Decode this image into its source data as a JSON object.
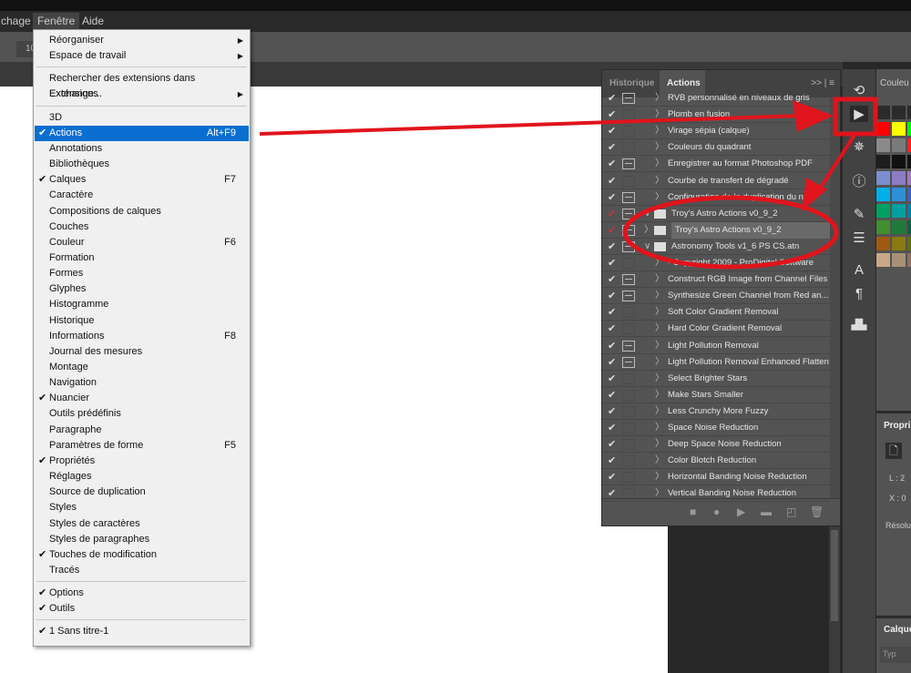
{
  "menubar": [
    "chage",
    "Fenêtre",
    "Aide"
  ],
  "optbar_value": "10",
  "menu": [
    {
      "label": "Réorganiser",
      "sub": true
    },
    {
      "label": "Espace de travail",
      "sub": true
    },
    {
      "sep": true
    },
    {
      "label": "Rechercher des extensions dans Exchange..."
    },
    {
      "label": "Extensions",
      "sub": true
    },
    {
      "sep": true
    },
    {
      "label": "3D"
    },
    {
      "label": "Actions",
      "check": true,
      "shortcut": "Alt+F9",
      "selected": true
    },
    {
      "label": "Annotations"
    },
    {
      "label": "Bibliothèques"
    },
    {
      "label": "Calques",
      "check": true,
      "shortcut": "F7"
    },
    {
      "label": "Caractère"
    },
    {
      "label": "Compositions de calques"
    },
    {
      "label": "Couches"
    },
    {
      "label": "Couleur",
      "shortcut": "F6"
    },
    {
      "label": "Formation"
    },
    {
      "label": "Formes"
    },
    {
      "label": "Glyphes"
    },
    {
      "label": "Histogramme"
    },
    {
      "label": "Historique"
    },
    {
      "label": "Informations",
      "shortcut": "F8"
    },
    {
      "label": "Journal des mesures"
    },
    {
      "label": "Montage"
    },
    {
      "label": "Navigation"
    },
    {
      "label": "Nuancier",
      "check": true
    },
    {
      "label": "Outils prédéfinis"
    },
    {
      "label": "Paragraphe"
    },
    {
      "label": "Paramètres de forme",
      "shortcut": "F5"
    },
    {
      "label": "Propriétés",
      "check": true
    },
    {
      "label": "Réglages"
    },
    {
      "label": "Source de duplication"
    },
    {
      "label": "Styles"
    },
    {
      "label": "Styles de caractères"
    },
    {
      "label": "Styles de paragraphes"
    },
    {
      "label": "Touches de modification",
      "check": true
    },
    {
      "label": "Tracés"
    },
    {
      "sep": true
    },
    {
      "label": "Options",
      "check": true
    },
    {
      "label": "Outils",
      "check": true
    },
    {
      "sep": true
    },
    {
      "label": "1 Sans titre-1",
      "check": true
    }
  ],
  "panel": {
    "tabs": [
      "Historique",
      "Actions"
    ],
    "menu_glyphs": ">>  |  ≡",
    "rows": [
      {
        "label": "RVB personnalisé en niveaux de gris",
        "dlg": true
      },
      {
        "label": "Plomb en fusion"
      },
      {
        "label": "Virage sépia (calque)"
      },
      {
        "label": "Couleurs du quadrant"
      },
      {
        "label": "Enregistrer au format Photoshop PDF",
        "dlg": true
      },
      {
        "label": "Courbe de transfert de dégradé"
      },
      {
        "label": "Configuration de la duplication du ni...",
        "dlg": true
      },
      {
        "label": "Troy's Astro Actions v0_9_2",
        "dlg": true,
        "red": true,
        "folder": true,
        "tw": "∨"
      },
      {
        "label": "Troy's Astro Actions v0_9_2",
        "dlg": true,
        "red": true,
        "folder": true,
        "hl": true
      },
      {
        "label": "Astronomy Tools v1_6 PS CS.atn",
        "dlg": true,
        "folder": true,
        "tw": "∨"
      },
      {
        "label": "- Copyright 2009 - ProDigital Software"
      },
      {
        "label": "Construct RGB Image from Channel Files",
        "dlg": true
      },
      {
        "label": "Synthesize Green Channel from Red an...",
        "dlg": true
      },
      {
        "label": "Soft Color Gradient Removal"
      },
      {
        "label": "Hard Color Gradient Removal"
      },
      {
        "label": "Light Pollution Removal",
        "dlg": true
      },
      {
        "label": "Light Pollution Removal Enhanced Flatten",
        "dlg": true
      },
      {
        "label": "Select Brighter Stars"
      },
      {
        "label": "Make Stars Smaller"
      },
      {
        "label": "Less Crunchy More Fuzzy"
      },
      {
        "label": "Space Noise Reduction"
      },
      {
        "label": "Deep Space Noise Reduction"
      },
      {
        "label": "Color Blotch Reduction"
      },
      {
        "label": "Horizontal Banding Noise Reduction"
      },
      {
        "label": "Vertical Banding Noise Reduction"
      }
    ]
  },
  "right": {
    "couleur": "Couleu",
    "proprietes": "Propri",
    "l": "L :  2",
    "x": "X :  0",
    "resolution": "Résolut",
    "calques": "Calque",
    "search": "Typ"
  },
  "annotation_color": "#e0141c"
}
